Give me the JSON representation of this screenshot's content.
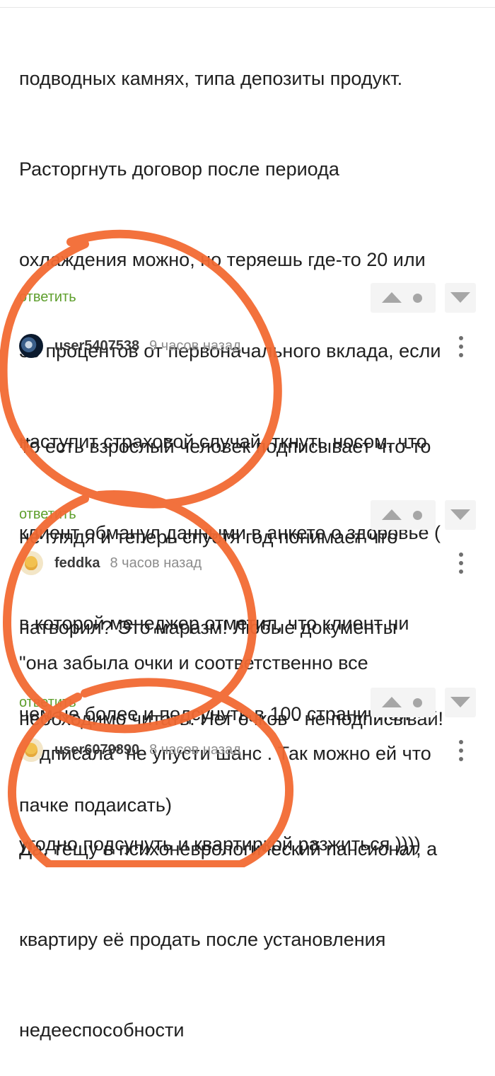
{
  "comments": [
    {
      "text_lines": [
        "подводных камнях, типа депозиты продукт.",
        "Расторгнуть договор после периода",
        "охлаждения можно, но теряешь где-то 20 или",
        "30 процентов от первоначального вклада, если",
        "наступит страховой случай, ткнуть носом, что",
        "клиент обманул данными в анкете о здоровье (",
        "в которой менеджер отметил, что клиент ни",
        "чем не более и подсунуть в 100 страничной",
        "пачке подаисать)"
      ],
      "reply_label": "ответить"
    },
    {
      "username": "user5407538",
      "time": "9 часов назад",
      "text_lines": [
        "То есть взрослый человек подписывает что-то",
        "не глядя и теперь спустя год понимает что",
        "натворил? Это маразм! Любые документы",
        "необходимо читать. Нет очков - не подписывай!"
      ],
      "reply_label": "ответить"
    },
    {
      "username": "feddka",
      "time": "8 часов назад",
      "text_lines": [
        "\"она забыла очки и соответственно все",
        "подписала\" не упусти шанс . Так можно ей что",
        "угодно подсунуть и квартиркой разжиться ))))"
      ],
      "reply_label": "ответить"
    },
    {
      "username": "user6079890",
      "time": "8 часов назад",
      "text_lines": [
        "Да, тёщу в психоневрологический пансионат, а",
        "квартиру её продать после установления",
        "недееспособности"
      ]
    }
  ],
  "icons": {
    "upvote": "triangle-up-icon",
    "rating": "dot-icon",
    "downvote": "triangle-down-icon",
    "more": "more-vertical-icon"
  },
  "colors": {
    "reply_link": "#5d9e2b",
    "annotation_stroke": "#f26a33"
  }
}
